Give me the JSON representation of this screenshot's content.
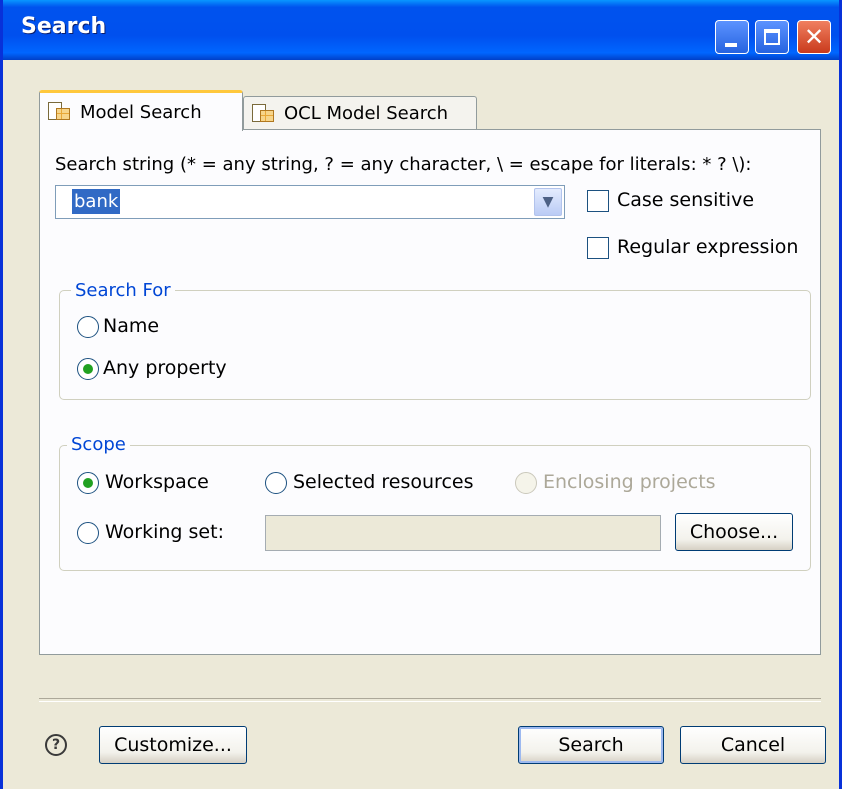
{
  "window": {
    "title": "Search"
  },
  "tabs": [
    {
      "label": "Model Search",
      "icon": "model-search-icon",
      "active": true
    },
    {
      "label": "OCL Model Search",
      "icon": "ocl-model-search-icon",
      "active": false
    }
  ],
  "search": {
    "string_label": "Search string (* = any string, ? = any character, \\ = escape for literals: * ? \\):",
    "value": "bank",
    "case_sensitive": {
      "label": "Case sensitive",
      "checked": false
    },
    "regular_expression": {
      "label": "Regular expression",
      "checked": false
    }
  },
  "search_for": {
    "title": "Search For",
    "options": [
      {
        "label": "Name",
        "selected": false
      },
      {
        "label": "Any property",
        "selected": true
      }
    ]
  },
  "scope": {
    "title": "Scope",
    "workspace": {
      "label": "Workspace",
      "selected": true
    },
    "selected_resources": {
      "label": "Selected resources",
      "selected": false
    },
    "enclosing_projects": {
      "label": "Enclosing projects",
      "selected": false,
      "enabled": false
    },
    "working_set": {
      "label": "Working set:",
      "selected": false,
      "value": ""
    },
    "choose_label": "Choose..."
  },
  "footer": {
    "customize_label": "Customize...",
    "search_label": "Search",
    "cancel_label": "Cancel"
  },
  "colors": {
    "accent": "#0046D5",
    "titlebar": "#0053EE",
    "selection": "#316AC5",
    "radio_dot": "#21A121"
  }
}
